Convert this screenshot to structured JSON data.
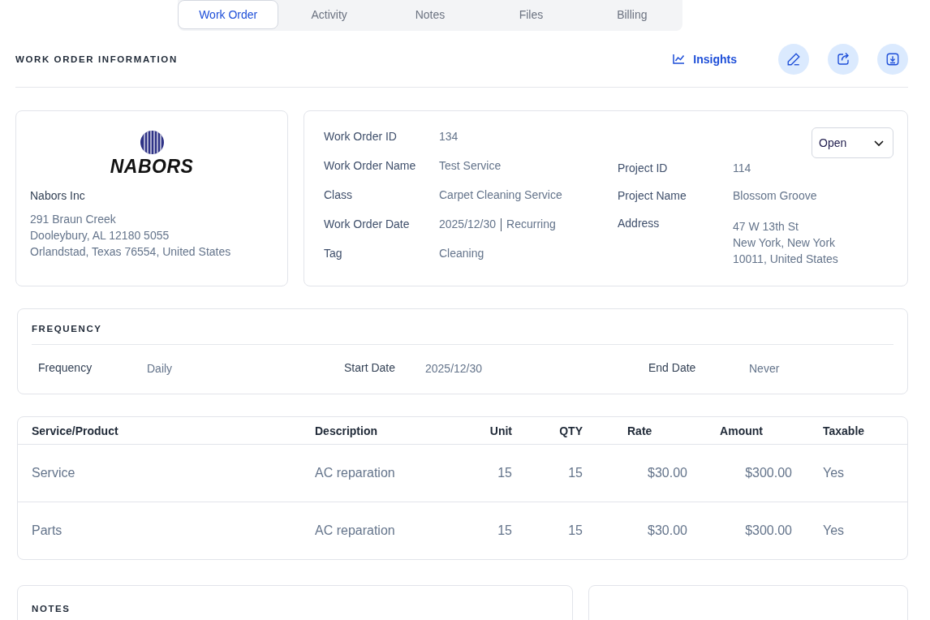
{
  "tabs": [
    {
      "label": "Work Order",
      "selected": true
    },
    {
      "label": "Activity",
      "selected": false
    },
    {
      "label": "Notes",
      "selected": false
    },
    {
      "label": "Files",
      "selected": false
    },
    {
      "label": "Billing",
      "selected": false
    }
  ],
  "section_title": "WORK ORDER INFORMATION",
  "actions": {
    "insights": "Insights"
  },
  "company": {
    "logo_text": "NABORS",
    "name": "Nabors Inc",
    "address_lines": [
      "291 Braun Creek",
      "Dooleybury, AL 12180 5055",
      "Orlandstad, Texas 76554, United States"
    ]
  },
  "details": {
    "status": "Open",
    "left_fields": [
      {
        "label": "Work Order ID",
        "value": "134"
      },
      {
        "label": "Work Order Name",
        "value": "Test Service"
      },
      {
        "label": "Class",
        "value": "Carpet Cleaning Service"
      },
      {
        "label": "Work Order Date",
        "value": "2025/12/30",
        "extra": "Recurring"
      },
      {
        "label": "Tag",
        "value": "Cleaning"
      }
    ],
    "right_fields": [
      {
        "label": "Project ID",
        "lines": [
          "114"
        ]
      },
      {
        "label": "Project Name",
        "lines": [
          "Blossom Groove"
        ]
      },
      {
        "label": "Address",
        "lines": [
          "47 W 13th St",
          "New York, New York",
          "10011, United States"
        ]
      }
    ]
  },
  "frequency": {
    "title": "FREQUENCY",
    "fields": [
      {
        "label": "Frequency",
        "value": "Daily"
      },
      {
        "label": "Start Date",
        "value": "2025/12/30"
      },
      {
        "label": "End Date",
        "value": "Never"
      }
    ]
  },
  "table": {
    "columns": [
      "Service/Product",
      "Description",
      "Unit",
      "QTY",
      "Rate",
      "Amount",
      "Taxable"
    ],
    "rows": [
      [
        "Service",
        "AC reparation",
        "15",
        "15",
        "$30.00",
        "$300.00",
        "Yes"
      ],
      [
        "Parts",
        "AC reparation",
        "15",
        "15",
        "$30.00",
        "$300.00",
        "Yes"
      ]
    ]
  },
  "notes": {
    "title": "NOTES"
  }
}
